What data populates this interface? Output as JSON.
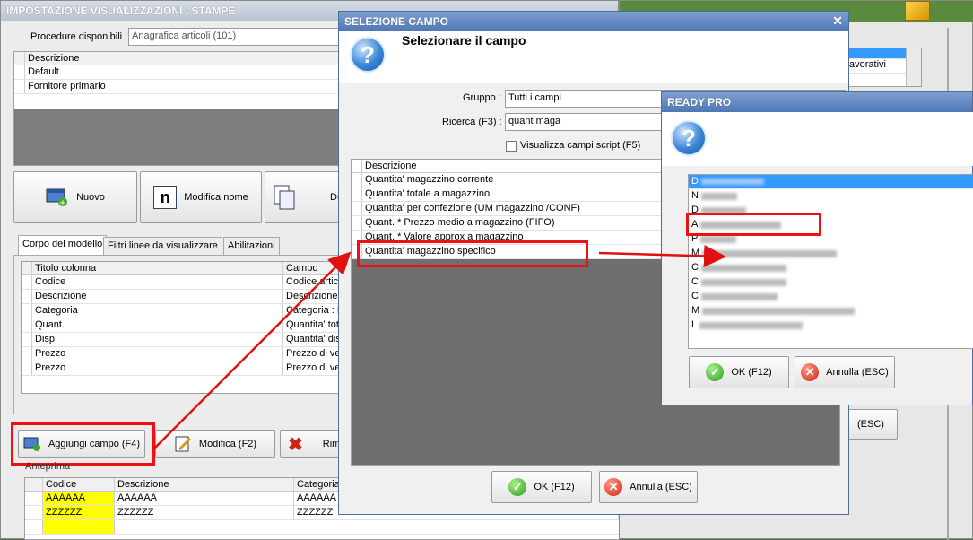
{
  "main_window": {
    "title": "IMPOSTAZIONE VISUALIZZAZIONI / STAMPE",
    "procedure_label": "Procedure disponibili :",
    "procedure_value": "Anagrafica articoli (101)",
    "list_header": "Descrizione",
    "list_items": [
      "Default",
      "Fornitore primario"
    ],
    "btn_nuovo": "Nuovo",
    "btn_modifica_nome": "Modifica nome",
    "btn_duplica_partial": "Du",
    "tabs": [
      "Corpo del modello",
      "Filtri linee da visualizzare",
      "Abilitazioni"
    ],
    "columns_header": [
      "Titolo colonna",
      "Campo"
    ],
    "columns_rows": [
      [
        "Codice",
        "Codice artic"
      ],
      [
        "Descrizione",
        "Descrizione a"
      ],
      [
        "Categoria",
        "Categoria : D"
      ],
      [
        "Quant.",
        "Quantita' tot"
      ],
      [
        "Disp.",
        "Quantita' dis"
      ],
      [
        "Prezzo",
        "Prezzo di ver"
      ],
      [
        "Prezzo",
        "Prezzo di ver"
      ]
    ],
    "btn_aggiungi": "Aggiungi campo (F4)",
    "btn_modifica": "Modifica (F2)",
    "btn_rimuovi_partial": "Rim",
    "anteprima_label": "Anteprima",
    "preview_header": [
      "Codice",
      "Descrizione",
      "Categoria"
    ],
    "preview_rows": [
      [
        "AAAAAA",
        "AAAAAA",
        "AAAAAA"
      ],
      [
        "ZZZZZZ",
        "ZZZZZZ",
        "ZZZZZZ"
      ]
    ]
  },
  "right_window": {
    "partial_item": "avorativi",
    "esc_partial": "(ESC)"
  },
  "dialog_campo": {
    "title": "SELEZIONE CAMPO",
    "heading": "Selezionare il campo",
    "gruppo_label": "Gruppo :",
    "gruppo_value": "Tutti i campi",
    "ricerca_label": "Ricerca (F3) :",
    "ricerca_value": "quant maga",
    "script_checkbox": "Visualizza campi script (F5)",
    "list_header": "Descrizione",
    "items": [
      "Quantita' magazzino corrente",
      "Quantita' totale a magazzino",
      "Quantita' per confezione (UM magazzino /CONF)",
      "Quant. * Prezzo medio a magazzino (FIFO)",
      "Quant. * Valore approx a magazzino",
      "Quantita' magazzino specifico"
    ],
    "ok": "OK (F12)",
    "cancel": "Annulla (ESC)"
  },
  "dialog_ready": {
    "title": "READY PRO",
    "items": [
      "D",
      "N",
      "D",
      "A",
      "P",
      "M",
      "C",
      "C",
      "C",
      "M",
      "L"
    ],
    "ok": "OK (F12)",
    "cancel": "Annulla (ESC)"
  },
  "colors": {
    "accent_red": "#e11111",
    "selection_blue": "#3399ff",
    "preview_yellow": "#ffff00"
  }
}
